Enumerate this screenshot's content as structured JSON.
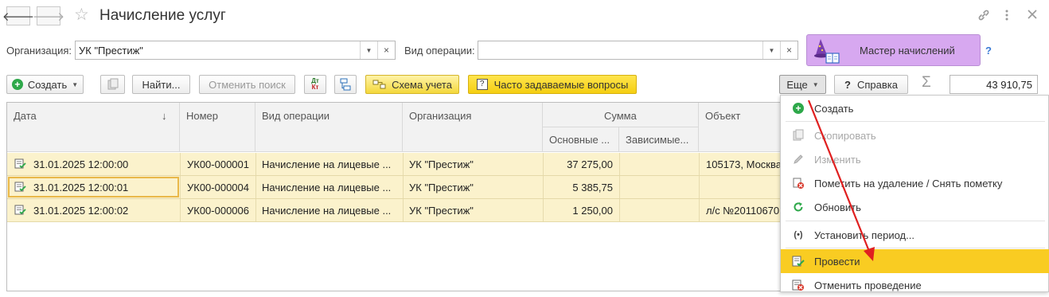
{
  "window": {
    "title": "Начисление услуг",
    "back_glyph": "🡐",
    "forward_glyph": "🡒"
  },
  "filters": {
    "org_label": "Организация:",
    "org_value": "УК \"Престиж\"",
    "optype_label": "Вид операции:",
    "optype_value": "",
    "wizard_label": "Мастер начислений",
    "help_mark": "?"
  },
  "toolbar": {
    "create": "Создать",
    "find": "Найти...",
    "cancel_search": "Отменить поиск",
    "dt_kt_top": "Дт",
    "dt_kt_bottom": "Кт",
    "scheme": "Схема учета",
    "faq": "Часто задаваемые вопросы",
    "more": "Еще",
    "help": "Справка",
    "help_mark": "?",
    "sigma": "Σ",
    "total": "43 910,75"
  },
  "table": {
    "headers": {
      "date": "Дата",
      "sort_mark": "↓",
      "number": "Номер",
      "optype": "Вид операции",
      "org": "Организация",
      "sum": "Сумма",
      "sum_main": "Основные ...",
      "sum_dep": "Зависимые...",
      "object": "Объект"
    },
    "rows": [
      {
        "date": "31.01.2025 12:00:00",
        "number": "УК00-000001",
        "optype": "Начисление на лицевые ...",
        "org": "УК \"Престиж\"",
        "sum_main": "37 275,00",
        "sum_dep": "",
        "object": "105173, Москва"
      },
      {
        "date": "31.01.2025 12:00:01",
        "number": "УК00-000004",
        "optype": "Начисление на лицевые ...",
        "org": "УК \"Престиж\"",
        "sum_main": "5 385,75",
        "sum_dep": "",
        "object": ""
      },
      {
        "date": "31.01.2025 12:00:02",
        "number": "УК00-000006",
        "optype": "Начисление на лицевые ...",
        "org": "УК \"Престиж\"",
        "sum_main": "1 250,00",
        "sum_dep": "",
        "object": "л/с №20110670"
      }
    ]
  },
  "menu": {
    "items": [
      {
        "label": "Создать",
        "icon": "plus-icon",
        "enabled": true
      },
      {
        "label": "Скопировать",
        "icon": "copy-icon",
        "enabled": false
      },
      {
        "label": "Изменить",
        "icon": "pencil-icon",
        "enabled": false
      },
      {
        "label": "Пометить на удаление / Снять пометку",
        "icon": "delete-mark-icon",
        "enabled": true
      },
      {
        "label": "Обновить",
        "icon": "refresh-icon",
        "enabled": true
      },
      {
        "label": "Установить период...",
        "icon": "period-icon",
        "enabled": true
      },
      {
        "label": "Провести",
        "icon": "post-icon",
        "enabled": true,
        "highlighted": true
      },
      {
        "label": "Отменить проведение",
        "icon": "unpost-icon",
        "enabled": true
      }
    ]
  },
  "colors": {
    "row_bg": "#fbf2cc",
    "highlight": "#f9cc22",
    "wizard_bg": "#d7a8f0",
    "accent_green": "#2ea84a",
    "arrow_red": "#e02020"
  }
}
